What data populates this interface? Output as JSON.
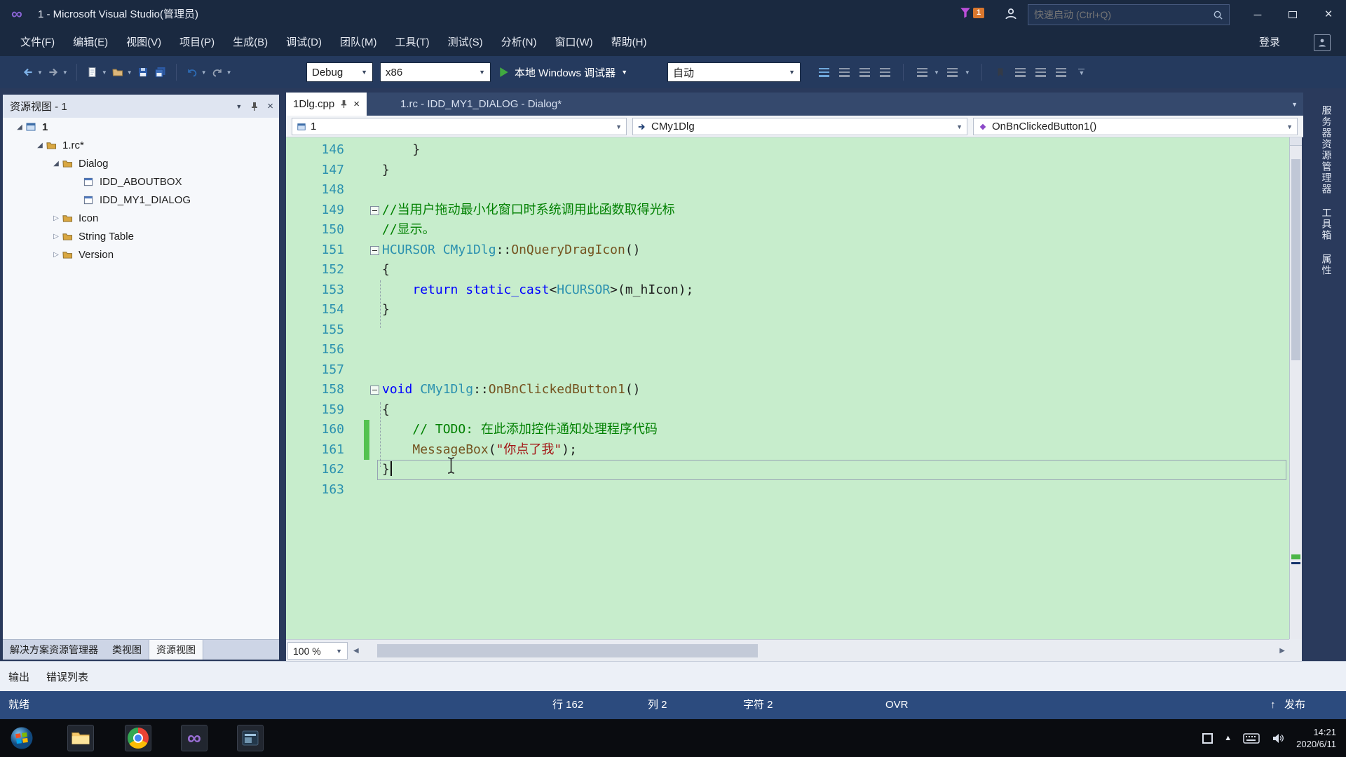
{
  "titlebar": {
    "title": "1 - Microsoft Visual Studio(管理员)",
    "notification_count": "1",
    "search_placeholder": "快速启动 (Ctrl+Q)"
  },
  "menubar": {
    "items": [
      "文件(F)",
      "编辑(E)",
      "视图(V)",
      "项目(P)",
      "生成(B)",
      "调试(D)",
      "团队(M)",
      "工具(T)",
      "测试(S)",
      "分析(N)",
      "窗口(W)",
      "帮助(H)"
    ],
    "signin": "登录"
  },
  "toolbar": {
    "config": "Debug",
    "platform": "x86",
    "debugger": "本地 Windows 调试器",
    "watch_mode": "自动",
    "left_icons": [
      {
        "name": "navigate-back-icon",
        "tone": "blue",
        "glyph": "arrow-left",
        "caret": true
      },
      {
        "name": "navigate-forward-icon",
        "tone": "gray",
        "glyph": "arrow-right",
        "caret": true
      },
      {
        "sep": true
      },
      {
        "name": "new-file-icon",
        "glyph": "page",
        "caret": true
      },
      {
        "name": "open-file-icon",
        "glyph": "folder",
        "caret": true
      },
      {
        "name": "save-icon",
        "glyph": "floppy"
      },
      {
        "name": "save-all-icon",
        "glyph": "floppy-all"
      },
      {
        "sep": true
      },
      {
        "name": "undo-icon",
        "tone": "blue",
        "glyph": "undo",
        "caret": true
      },
      {
        "name": "redo-icon",
        "tone": "gray",
        "glyph": "redo",
        "caret": true
      }
    ],
    "right_icons": [
      {
        "name": "breakpoints-window-icon",
        "glyph": "bars-blue"
      },
      {
        "name": "output-window-icon",
        "glyph": "bars"
      },
      {
        "name": "find-in-files-icon",
        "glyph": "bars"
      },
      {
        "name": "command-window-icon",
        "glyph": "bars"
      },
      {
        "sep": true
      },
      {
        "name": "navigate-backward-icon",
        "glyph": "bars",
        "caret": true
      },
      {
        "name": "navigate-forward2-icon",
        "glyph": "bars",
        "caret": true
      },
      {
        "sep": true
      },
      {
        "name": "bookmark-icon",
        "glyph": "bookmark"
      },
      {
        "name": "next-bookmark-icon",
        "glyph": "bars"
      },
      {
        "name": "prev-bookmark-icon",
        "glyph": "bars"
      },
      {
        "name": "clear-bookmarks-icon",
        "glyph": "bars"
      },
      {
        "name": "toolbar-overflow-chevron",
        "glyph": "chevron"
      }
    ]
  },
  "resource_panel": {
    "title": "资源视图 - 1",
    "tree": [
      {
        "label": "1",
        "level": 0,
        "expander": "open",
        "icon": "resource-root",
        "root": true
      },
      {
        "label": "1.rc*",
        "level": 1,
        "expander": "open",
        "icon": "folder"
      },
      {
        "label": "Dialog",
        "level": 2,
        "expander": "open",
        "icon": "folder"
      },
      {
        "label": "IDD_ABOUTBOX",
        "level": 3,
        "expander": "leaf",
        "icon": "dialog"
      },
      {
        "label": "IDD_MY1_DIALOG",
        "level": 3,
        "expander": "leaf",
        "icon": "dialog"
      },
      {
        "label": "Icon",
        "level": 2,
        "expander": "closed",
        "icon": "folder"
      },
      {
        "label": "String Table",
        "level": 2,
        "expander": "closed",
        "icon": "folder"
      },
      {
        "label": "Version",
        "level": 2,
        "expander": "closed",
        "icon": "folder"
      }
    ],
    "bottom_tabs": [
      {
        "label": "解决方案资源管理器",
        "active": false
      },
      {
        "label": "类视图",
        "active": false
      },
      {
        "label": "资源视图",
        "active": true
      }
    ]
  },
  "editor": {
    "tabs": [
      {
        "label": "1Dlg.cpp",
        "active": true
      },
      {
        "label": "1.rc - IDD_MY1_DIALOG - Dialog*",
        "active": false
      }
    ],
    "navbar": {
      "scope": "1",
      "type": "CMy1Dlg",
      "member": "OnBnClickedButton1()"
    },
    "zoom": "100 %",
    "code": [
      {
        "n": 146,
        "toks": [
          [
            "pl",
            "    }"
          ]
        ]
      },
      {
        "n": 147,
        "toks": [
          [
            "pl",
            "}"
          ]
        ]
      },
      {
        "n": 148,
        "toks": []
      },
      {
        "n": 149,
        "fold": true,
        "toks": [
          [
            "cm",
            "//当用户拖动最小化窗口时系统调用此函数取得光标"
          ]
        ]
      },
      {
        "n": 150,
        "toks": [
          [
            "cm",
            "//显示。"
          ]
        ]
      },
      {
        "n": 151,
        "fold": true,
        "toks": [
          [
            "ty",
            "HCURSOR"
          ],
          [
            "pl",
            " "
          ],
          [
            "ty",
            "CMy1Dlg"
          ],
          [
            "pl",
            "::"
          ],
          [
            "fn",
            "OnQueryDragIcon"
          ],
          [
            "pl",
            "()"
          ]
        ]
      },
      {
        "n": 152,
        "toks": [
          [
            "pl",
            "{"
          ]
        ]
      },
      {
        "n": 153,
        "toks": [
          [
            "pl",
            "    "
          ],
          [
            "kw",
            "return"
          ],
          [
            "pl",
            " "
          ],
          [
            "kw",
            "static_cast"
          ],
          [
            "pl",
            "<"
          ],
          [
            "ty",
            "HCURSOR"
          ],
          [
            "pl",
            ">(m_hIcon);"
          ]
        ]
      },
      {
        "n": 154,
        "toks": [
          [
            "pl",
            "}"
          ]
        ]
      },
      {
        "n": 155,
        "toks": []
      },
      {
        "n": 156,
        "toks": []
      },
      {
        "n": 157,
        "toks": []
      },
      {
        "n": 158,
        "fold": true,
        "toks": [
          [
            "kw",
            "void"
          ],
          [
            "pl",
            " "
          ],
          [
            "ty",
            "CMy1Dlg"
          ],
          [
            "pl",
            "::"
          ],
          [
            "fn",
            "OnBnClickedButton1"
          ],
          [
            "pl",
            "()"
          ]
        ]
      },
      {
        "n": 159,
        "toks": [
          [
            "pl",
            "{"
          ]
        ]
      },
      {
        "n": 160,
        "changed": true,
        "toks": [
          [
            "pl",
            "    "
          ],
          [
            "cm",
            "// TODO: 在此添加控件通知处理程序代码"
          ]
        ]
      },
      {
        "n": 161,
        "changed": true,
        "toks": [
          [
            "pl",
            "    "
          ],
          [
            "fn",
            "MessageBox"
          ],
          [
            "pl",
            "("
          ],
          [
            "st",
            "\"你点了我\""
          ],
          [
            "pl",
            ");"
          ]
        ]
      },
      {
        "n": 162,
        "current": true,
        "caret": true,
        "toks": [
          [
            "pl",
            "}"
          ]
        ]
      },
      {
        "n": 163,
        "toks": []
      }
    ]
  },
  "right_panel_tabs": [
    "服务器资源管理器",
    "工具箱",
    "属性"
  ],
  "output_tabs": [
    "输出",
    "错误列表"
  ],
  "statusbar": {
    "state": "就绪",
    "line": "行 162",
    "column": "列 2",
    "char": "字符 2",
    "mode": "OVR",
    "publish": "发布"
  },
  "taskbar": {
    "time": "14:21",
    "date": "2020/6/11",
    "apps": [
      "start",
      "file-explorer",
      "chrome",
      "visual-studio",
      "running-app"
    ],
    "tray": [
      "ime",
      "hidden-icons",
      "keyboard",
      "volume"
    ]
  },
  "colors": {
    "editor_bg": "#C7EDCC",
    "keyword": "#0000FF",
    "type": "#2B91AF",
    "comment": "#008000",
    "string": "#A31515",
    "function": "#74531F",
    "change_bar": "#53C24F",
    "chrome_bg": "#1A2940"
  }
}
